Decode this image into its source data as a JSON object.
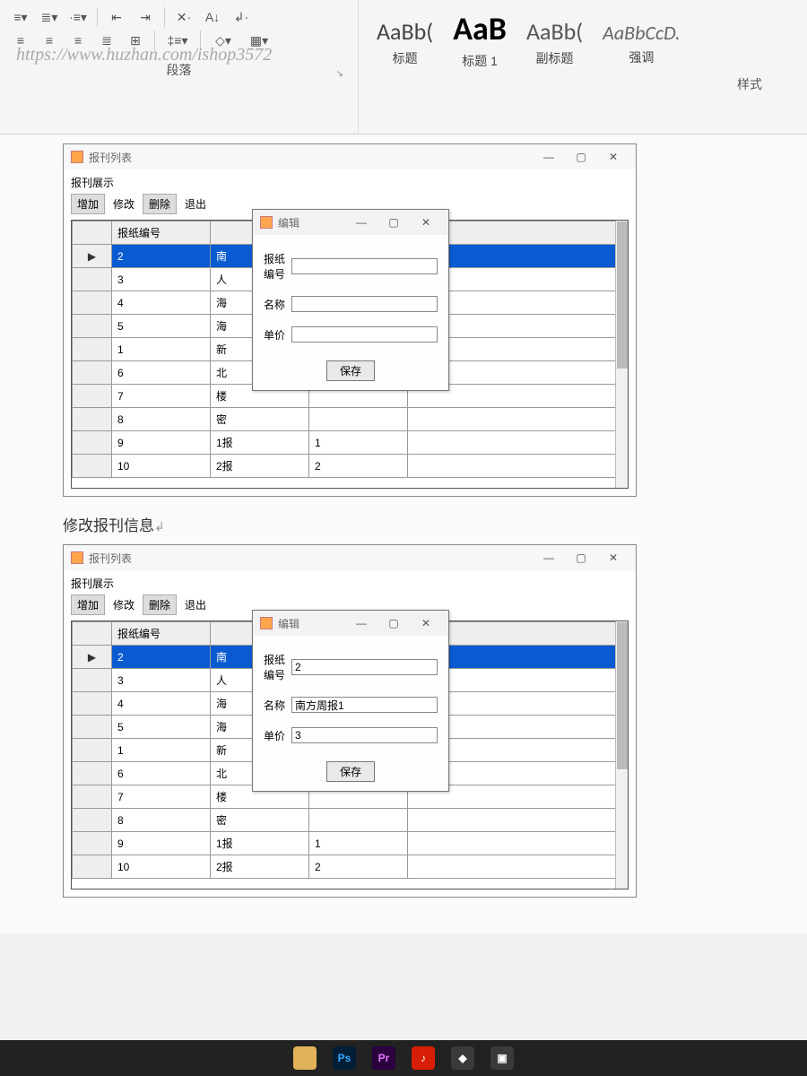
{
  "watermark": "https://www.huzhan.com/ishop3572",
  "ribbon": {
    "paragraph_label": "段落",
    "styles_label": "样式",
    "styles": [
      {
        "sample": "AaBb(",
        "name": "标题",
        "cls": ""
      },
      {
        "sample": "AaB",
        "name": "标题 1",
        "cls": "bold"
      },
      {
        "sample": "AaBb(",
        "name": "副标题",
        "cls": "sub"
      },
      {
        "sample": "AaBbCcD.",
        "name": "强调",
        "cls": "emph"
      }
    ]
  },
  "list_window": {
    "title": "报刊列表",
    "section": "报刊展示",
    "toolbar": {
      "add": "增加",
      "edit": "修改",
      "del": "删除",
      "exit": "退出"
    },
    "col0": "",
    "col1": "报纸编号",
    "rows": [
      {
        "id": "2",
        "name": "南",
        "price": ""
      },
      {
        "id": "3",
        "name": "人",
        "price": ""
      },
      {
        "id": "4",
        "name": "海",
        "price": ""
      },
      {
        "id": "5",
        "name": "海",
        "price": ""
      },
      {
        "id": "1",
        "name": "新",
        "price": ""
      },
      {
        "id": "6",
        "name": "北",
        "price": ""
      },
      {
        "id": "7",
        "name": "楼",
        "price": ""
      },
      {
        "id": "8",
        "name": "密",
        "price": ""
      },
      {
        "id": "9",
        "name": "1报",
        "price": "1"
      },
      {
        "id": "10",
        "name": "2报",
        "price": "2"
      }
    ]
  },
  "edit_dialog": {
    "title": "编辑",
    "f_id": "报纸编号",
    "f_name": "名称",
    "f_price": "单价",
    "save": "保存"
  },
  "section2_caption": "修改报刊信息",
  "edit_values_top": {
    "id": "",
    "name": "",
    "price": ""
  },
  "edit_values_bottom": {
    "id": "2",
    "name": "南方周报1",
    "price": "3"
  }
}
